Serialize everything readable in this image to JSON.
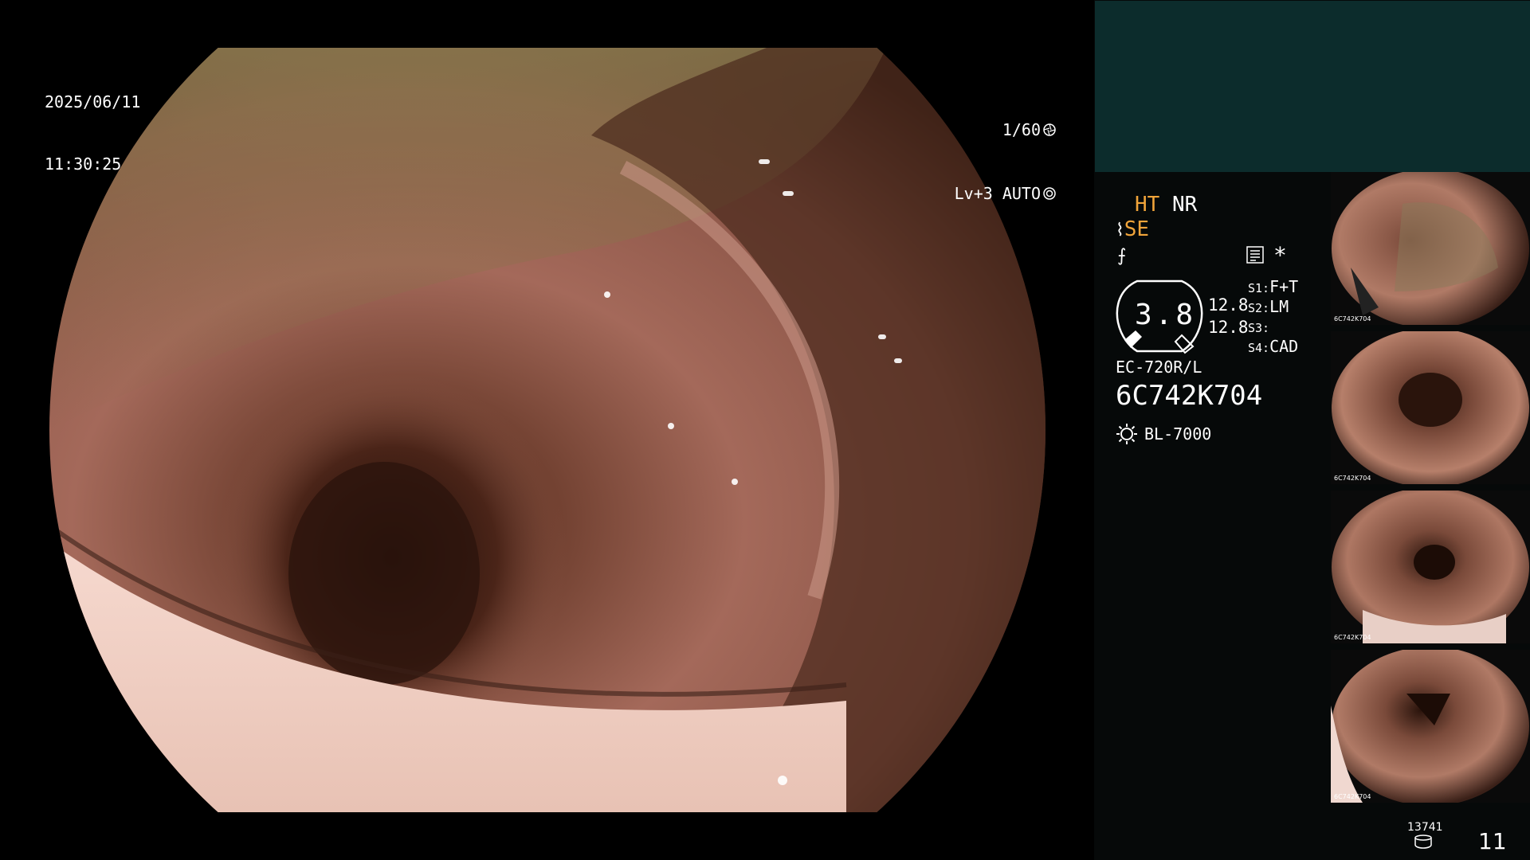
{
  "overlay": {
    "date": "2025/06/11",
    "time": "11:30:25",
    "shutter": "1/60",
    "level_mode": "Lv+3 AUTO"
  },
  "modes": {
    "ht": "HT",
    "nr": "NR",
    "se": "SE"
  },
  "gauge": {
    "value": "3.8",
    "side_top": "12.8",
    "side_bottom": "12.8"
  },
  "slots": [
    {
      "key": "S1:",
      "value": "F+T"
    },
    {
      "key": "S2:",
      "value": "LM"
    },
    {
      "key": "S3:",
      "value": ""
    },
    {
      "key": "S4:",
      "value": "CAD"
    }
  ],
  "scope": {
    "model": "EC-720R/L",
    "serial": "6C742K704",
    "light_source": "BL-7000"
  },
  "thumbnails": [
    {
      "label": "6C742K704"
    },
    {
      "label": "6C742K704"
    },
    {
      "label": "6C742K704"
    },
    {
      "label": "6C742K704"
    }
  ],
  "counter": {
    "count": "13741",
    "page": "11"
  },
  "colors": {
    "panel_top": "#0c2c2c",
    "panel_bg": "#060909",
    "highlight": "#f0a43a"
  }
}
